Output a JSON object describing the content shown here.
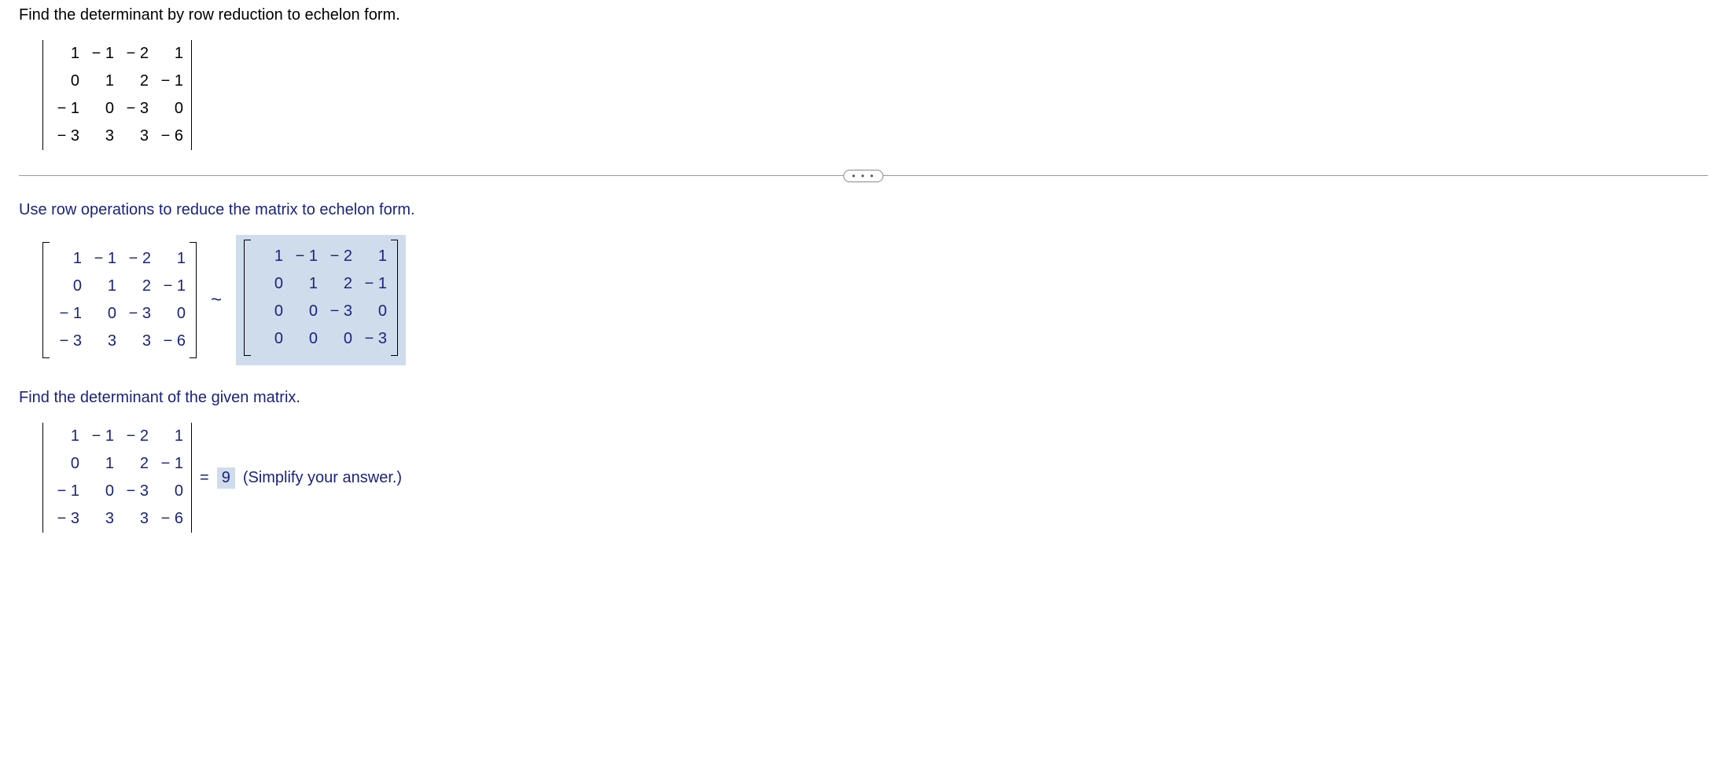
{
  "question": {
    "prompt": "Find the determinant by row reduction to echelon form.",
    "matrix": [
      [
        "1",
        "− 1",
        "− 2",
        "1"
      ],
      [
        "0",
        "1",
        "2",
        "− 1"
      ],
      [
        "− 1",
        "0",
        "− 3",
        "0"
      ],
      [
        "− 3",
        "3",
        "3",
        "− 6"
      ]
    ]
  },
  "divider": {
    "label": "• • •"
  },
  "step1": {
    "prompt": "Use row operations to reduce the matrix to echelon form.",
    "tilde": "~",
    "matrix_left": [
      [
        "1",
        "− 1",
        "− 2",
        "1"
      ],
      [
        "0",
        "1",
        "2",
        "− 1"
      ],
      [
        "− 1",
        "0",
        "− 3",
        "0"
      ],
      [
        "− 3",
        "3",
        "3",
        "− 6"
      ]
    ],
    "matrix_right": [
      [
        "1",
        "− 1",
        "− 2",
        "1"
      ],
      [
        "0",
        "1",
        "2",
        "− 1"
      ],
      [
        "0",
        "0",
        "− 3",
        "0"
      ],
      [
        "0",
        "0",
        "0",
        "− 3"
      ]
    ]
  },
  "step2": {
    "prompt": "Find the determinant of the given matrix.",
    "matrix": [
      [
        "1",
        "− 1",
        "− 2",
        "1"
      ],
      [
        "0",
        "1",
        "2",
        "− 1"
      ],
      [
        "− 1",
        "0",
        "− 3",
        "0"
      ],
      [
        "− 3",
        "3",
        "3",
        "− 6"
      ]
    ],
    "equals": "=",
    "answer": "9",
    "hint": "(Simplify your answer.)"
  }
}
